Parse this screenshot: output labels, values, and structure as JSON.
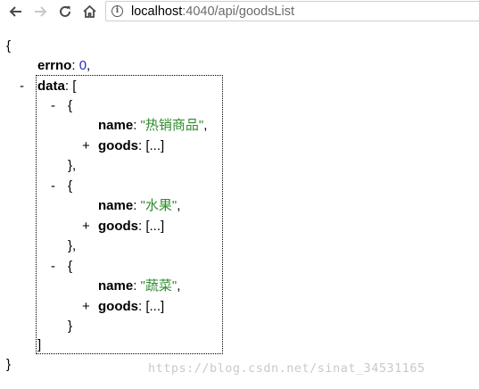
{
  "browser": {
    "url_host": "localhost",
    "url_path": ":4040/api/goodsList",
    "icons": [
      "back-arrow-icon",
      "forward-arrow-icon",
      "reload-icon",
      "home-icon",
      "info-icon"
    ]
  },
  "json": {
    "open_brace": "{",
    "close_brace": "}",
    "errno_key": "errno",
    "errno_value": "0",
    "data_key": "data",
    "data_open": "[",
    "data_close": "]",
    "collapse_symbol": "-",
    "expand_symbol": "+",
    "item_open": "{",
    "item_close_comma": "},",
    "item_close": "}",
    "name_key": "name",
    "goods_key": "goods",
    "goods_collapsed": "[...]",
    "items": [
      {
        "name": "\"热销商品\""
      },
      {
        "name": "\"水果\""
      },
      {
        "name": "\"蔬菜\""
      }
    ]
  },
  "watermark": "https://blog.csdn.net/sinat_34531165",
  "colors": {
    "string": "#2e8b2e",
    "number": "#2a2ac9",
    "url_path": "#6b6b6b"
  }
}
